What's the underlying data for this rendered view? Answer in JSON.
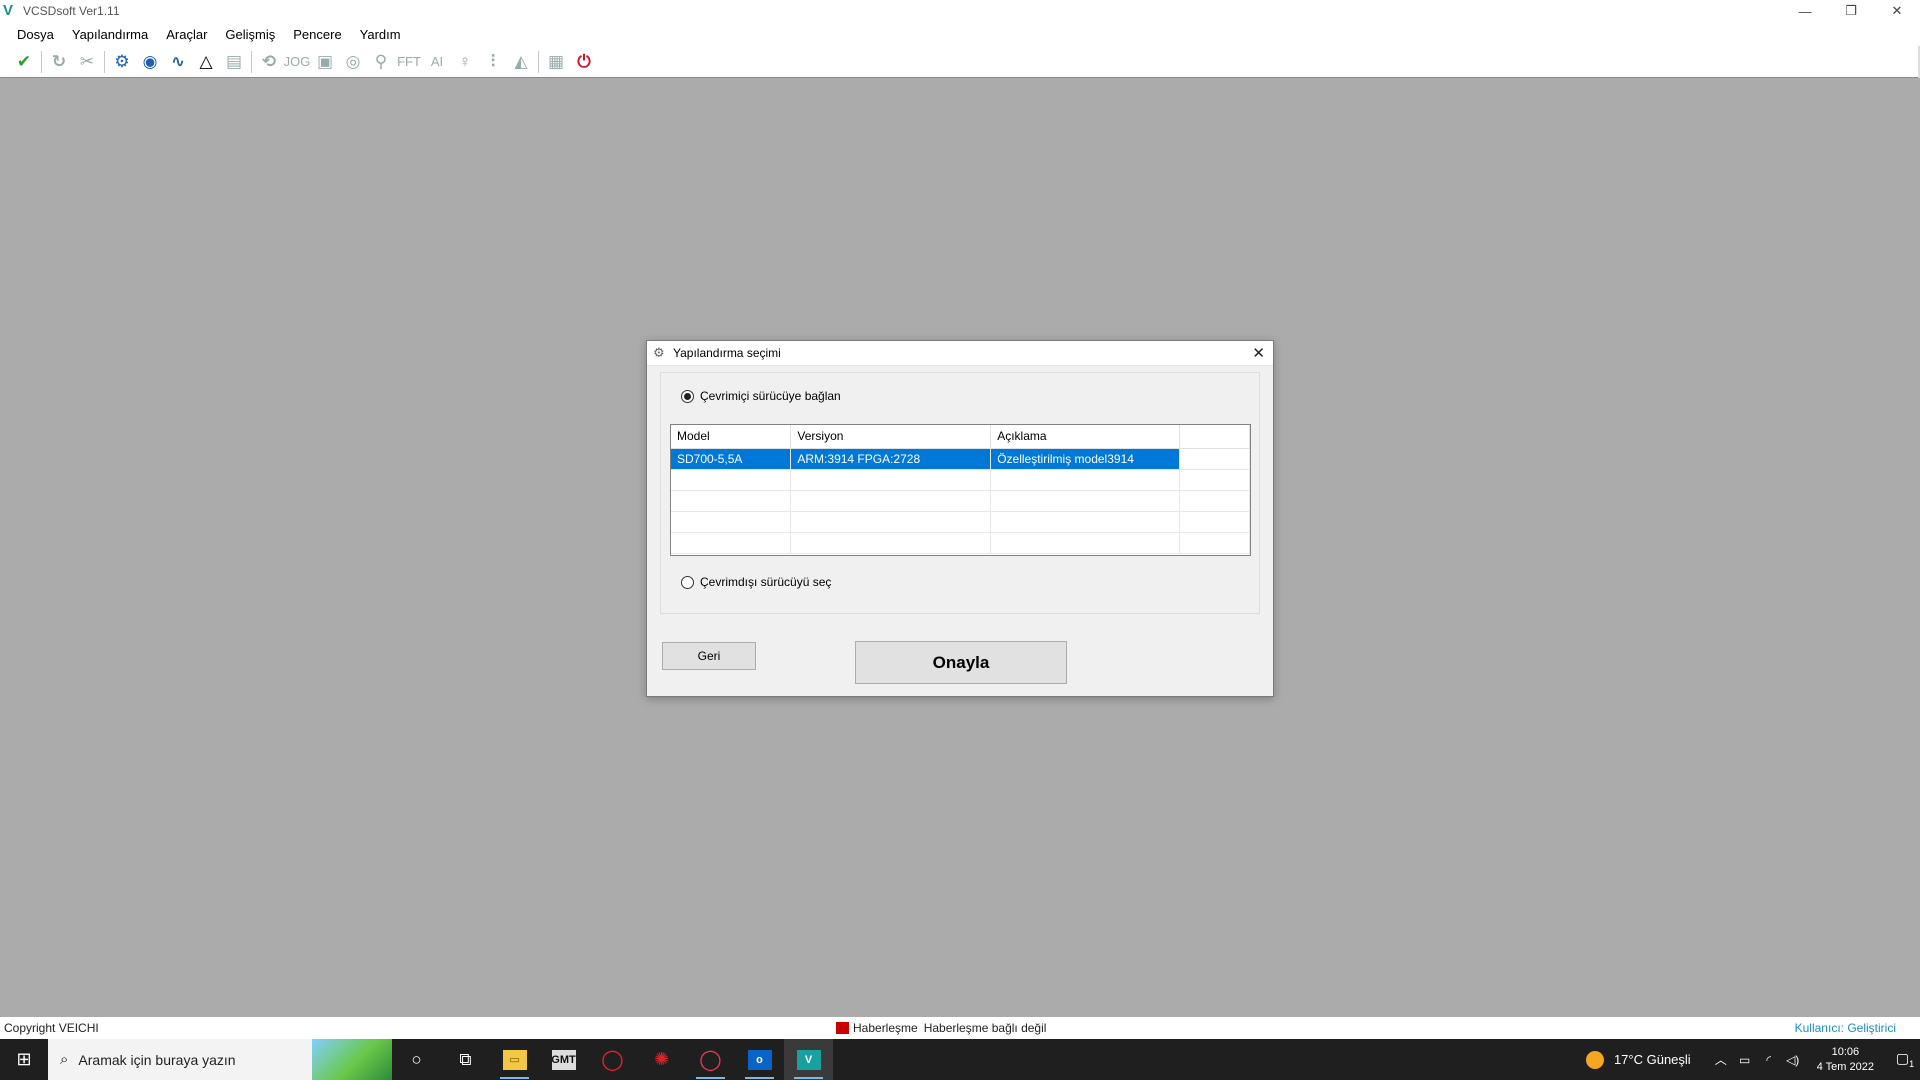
{
  "window": {
    "title": "VCSDsoft Ver1.11",
    "logo_glyph": "V",
    "controls": [
      "—",
      "❐",
      "✕"
    ]
  },
  "menu": [
    "Dosya",
    "Yapılandırma",
    "Araçlar",
    "Gelişmiş",
    "Pencere",
    "Yardım"
  ],
  "toolbar": {
    "jog_label": "JOG",
    "fft_label": "FFT",
    "ai_label": "AI"
  },
  "dialog": {
    "title": "Yapılandırma seçimi",
    "online_label": "Çevrimiçi sürücüye bağlan",
    "offline_label": "Çevrimdışı sürücüyü seç",
    "columns": [
      "Model",
      "Versiyon",
      "Açıklama"
    ],
    "rows": [
      {
        "model": "SD700-5,5A",
        "version": "ARM:3914 FPGA:2728",
        "description": "Özelleştirilmiş model3914"
      }
    ],
    "back_label": "Geri",
    "confirm_label": "Onayla"
  },
  "status": {
    "copyright": "Copyright  VEICHI",
    "comm_label": "Haberleşme",
    "comm_status": "Haberleşme bağlı değil",
    "user": "Kullanıcı: Geliştirici"
  },
  "taskbar": {
    "search_placeholder": "Aramak için buraya yazın",
    "gmt_label": "GMT",
    "weather": "17°C  Güneşli",
    "time": "10:06",
    "date": "4 Tem 2022",
    "notification_count": "1"
  },
  "colors": {
    "selection": "#0078d7",
    "comm_led": "#c80000",
    "user_text": "#1e8cbf"
  }
}
